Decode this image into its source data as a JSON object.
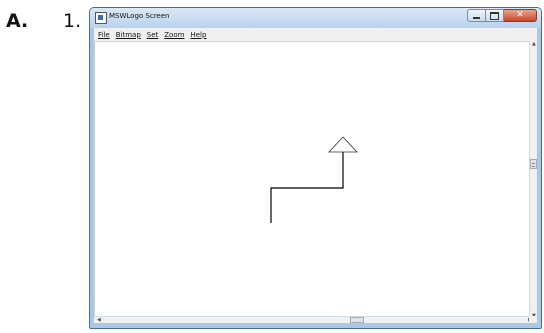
{
  "question": {
    "letter": "A.",
    "number": "1."
  },
  "window": {
    "title": "MSWLogo Screen",
    "close_glyph": "✕"
  },
  "menu": {
    "items": [
      {
        "label": "File"
      },
      {
        "label": "Bitmap"
      },
      {
        "label": "Set"
      },
      {
        "label": "Zoom"
      },
      {
        "label": "Help"
      }
    ]
  },
  "colors": {
    "frame": "#a9c7e7",
    "close_button": "#c6462b",
    "canvas": "#ffffff",
    "pen": "#000000"
  },
  "icons": {
    "app": "mswlogo-app-icon",
    "turtle": "turtle-triangle-icon"
  }
}
